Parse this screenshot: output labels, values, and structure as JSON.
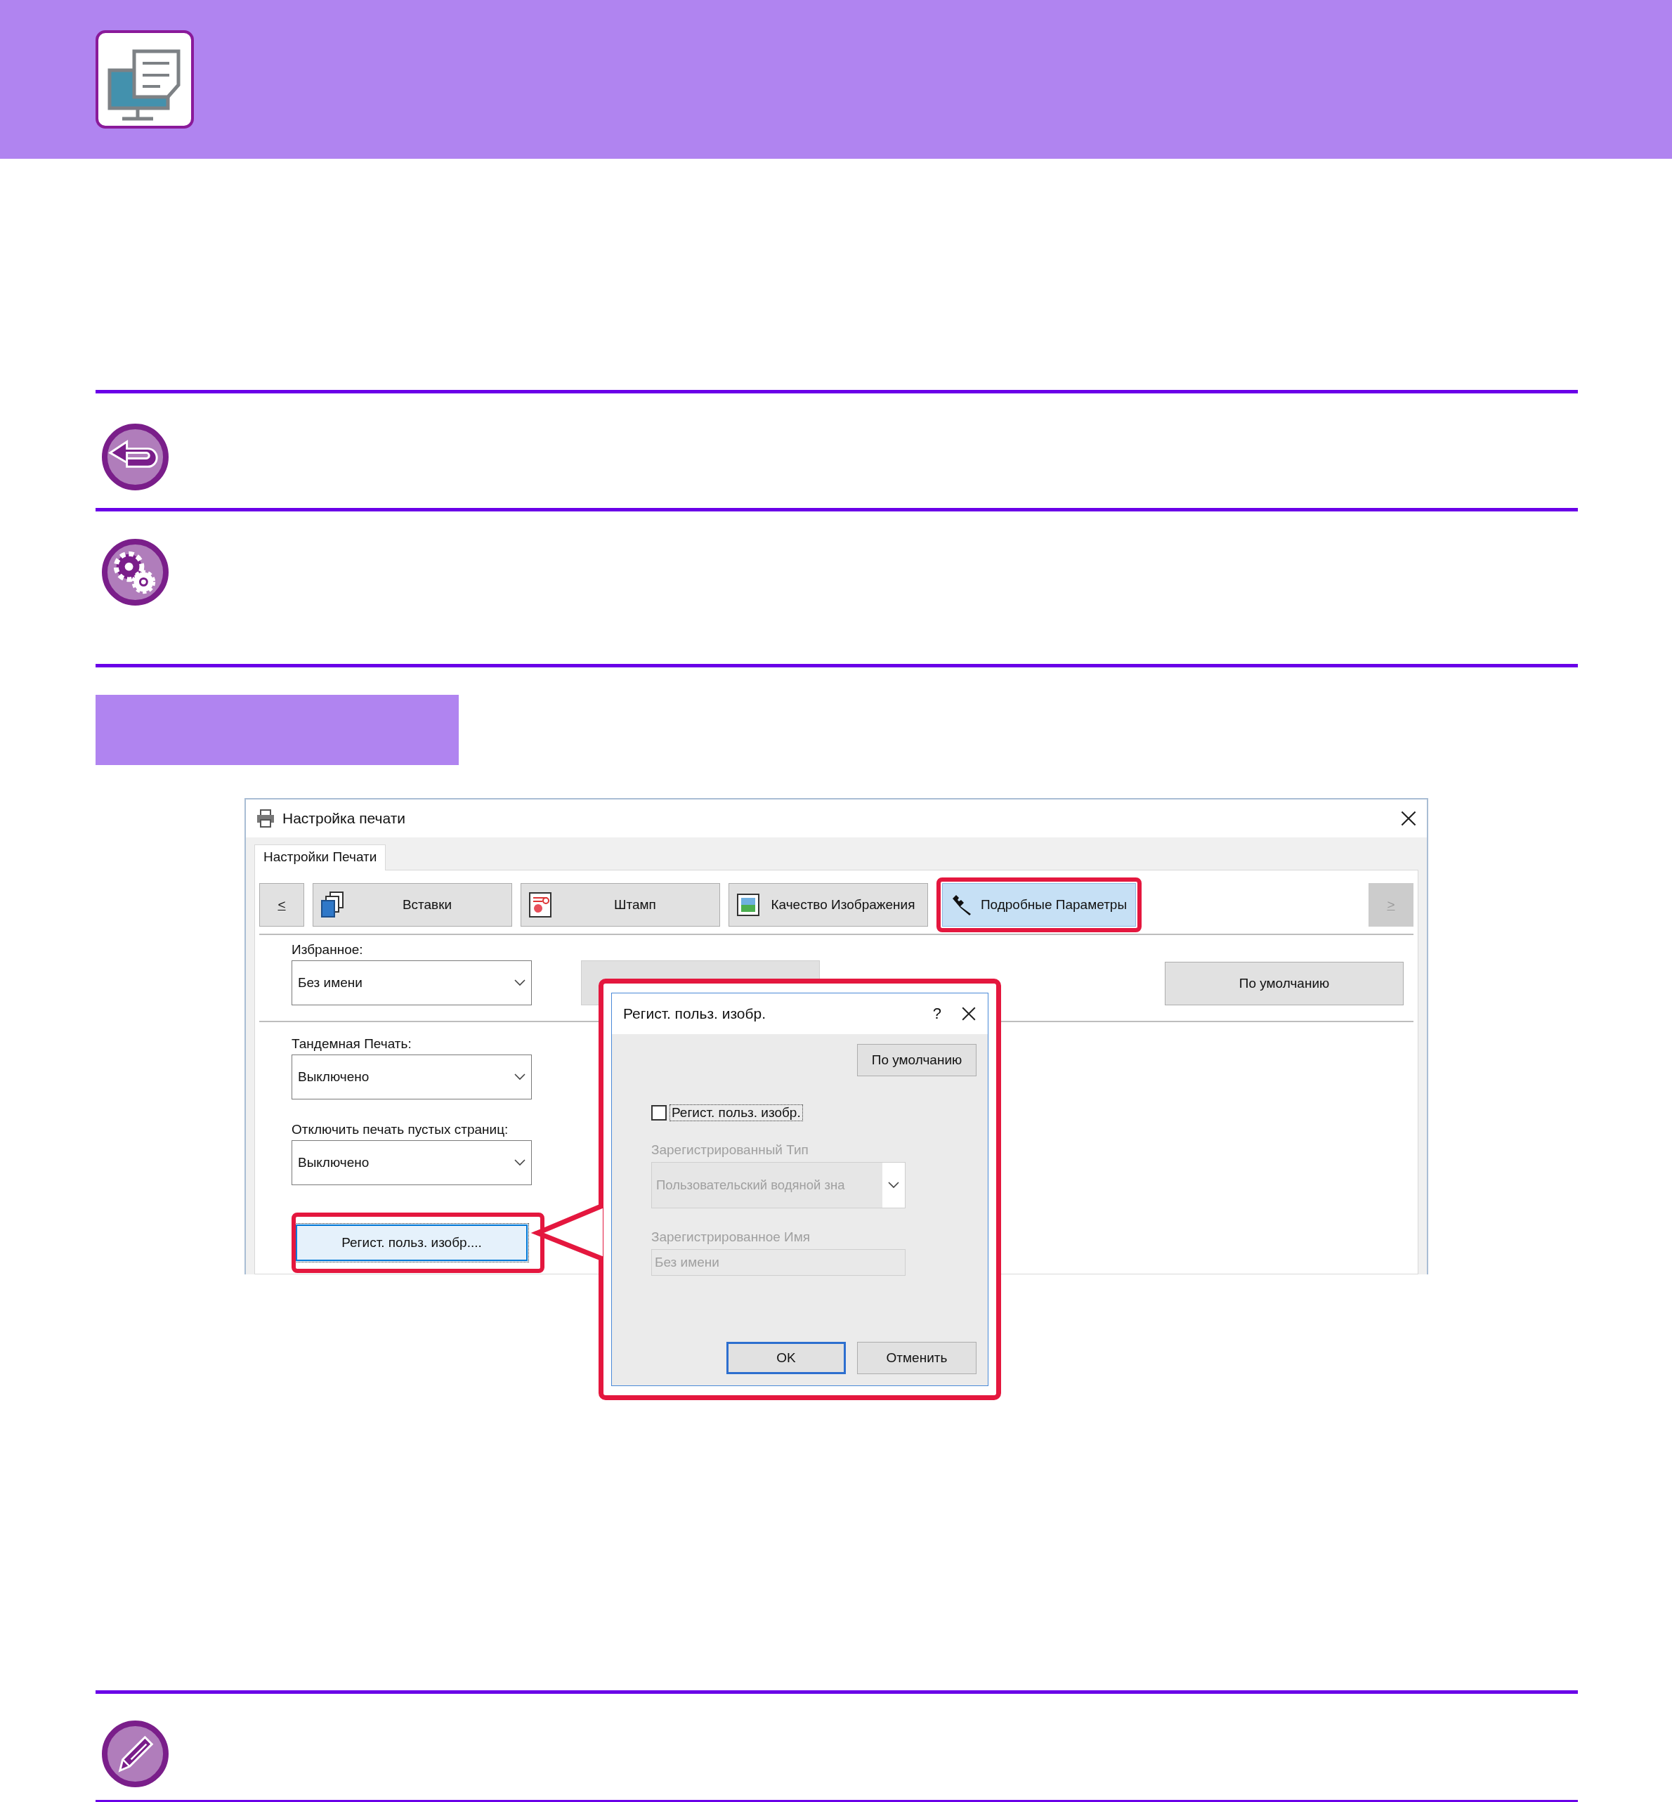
{
  "window": {
    "title": "Настройка печати"
  },
  "tabs": [
    {
      "label": "Настройки Печати",
      "selected": true
    }
  ],
  "toolbar": {
    "prev": {
      "label": "<",
      "disabled": false
    },
    "next": {
      "label": ">",
      "disabled": true
    },
    "categories": [
      {
        "label": "Вставки",
        "kind": "inserts",
        "selected": false,
        "highlighted": false
      },
      {
        "label": "Штамп",
        "kind": "stamp",
        "selected": false,
        "highlighted": false
      },
      {
        "label": "Качество Изображения",
        "kind": "image",
        "selected": false,
        "highlighted": false
      },
      {
        "label": "Подробные Параметры",
        "kind": "advanced",
        "selected": true,
        "highlighted": true
      }
    ]
  },
  "favorites": {
    "label": "Избранное:",
    "value": "Без имени"
  },
  "default_button": "По умолчанию",
  "settings": [
    {
      "label": "Тандемная Печать:",
      "value": "Выключено"
    },
    {
      "label": "Отключить печать пустых страниц:",
      "value": "Выключено"
    }
  ],
  "register_button": {
    "label": "Регист. польз. изобр....",
    "highlighted": true
  },
  "dialog": {
    "title": "Регист. польз. изобр.",
    "help": "?",
    "highlighted": true,
    "default_button": "По умолчанию",
    "checkbox": {
      "label": "Регист. польз. изобр.",
      "checked": false
    },
    "type_label": "Зарегистрированный Тип",
    "type_value": "Пользовательский водяной зна",
    "name_label": "Зарегистрированное Имя",
    "name_value": "Без имени",
    "disabled": true,
    "buttons": [
      {
        "label": "OK",
        "default": true
      },
      {
        "label": "Отменить",
        "default": false
      }
    ]
  }
}
